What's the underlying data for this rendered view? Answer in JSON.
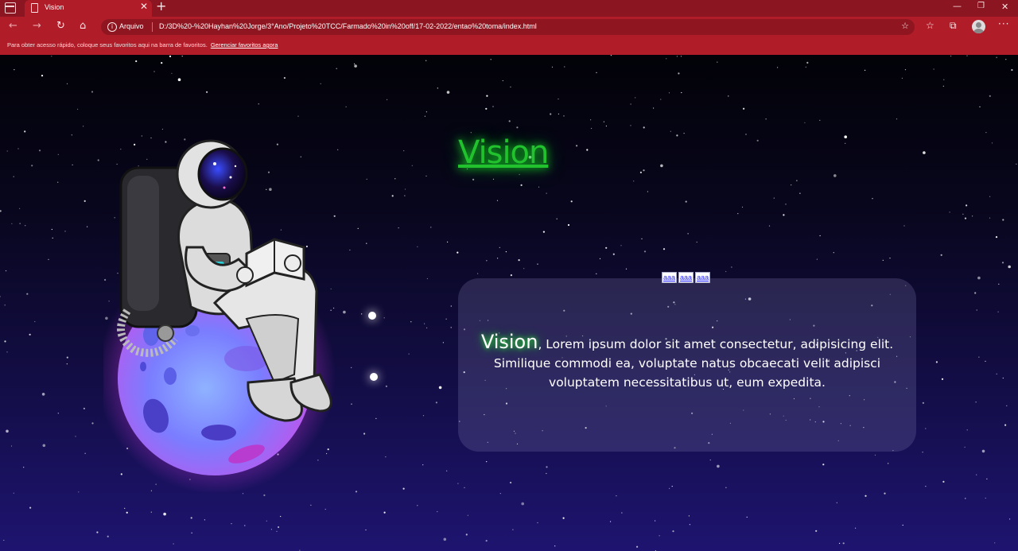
{
  "browser": {
    "tab_title": "Vision",
    "address_label": "Arquivo",
    "url": "D:/3D%20-%20Hayhan%20Jorge/3°Ano/Projeto%20TCC/Farmado%20in%20off/17-02-2022/entao%20toma/index.html",
    "favorites_hint": "Para obter acesso rápido, coloque seus favoritos aqui na barra de favoritos.",
    "favorites_link": "Gerenciar favoritos agora"
  },
  "page": {
    "title": "Vision",
    "nav_links": [
      "aaa",
      "aaa",
      "aaa"
    ],
    "card": {
      "brand": "Vision",
      "text": ", Lorem ipsum dolor sit amet consectetur, adipisicing elit. Similique commodi ea, voluptate natus obcaecati velit adipisci voluptatem necessitatibus ut, eum expedita."
    }
  },
  "colors": {
    "browser_accent": "#b01c28",
    "title_green": "#22c22e",
    "space_bottom": "#1e1470"
  },
  "icons": [
    "tab-actions-icon",
    "page-icon",
    "close-icon",
    "plus-icon",
    "back-icon",
    "forward-icon",
    "refresh-icon",
    "home-icon",
    "info-icon",
    "add-favorite-icon",
    "favorites-icon",
    "collections-icon",
    "profile-icon",
    "more-icon",
    "minimize-icon",
    "restore-icon"
  ]
}
